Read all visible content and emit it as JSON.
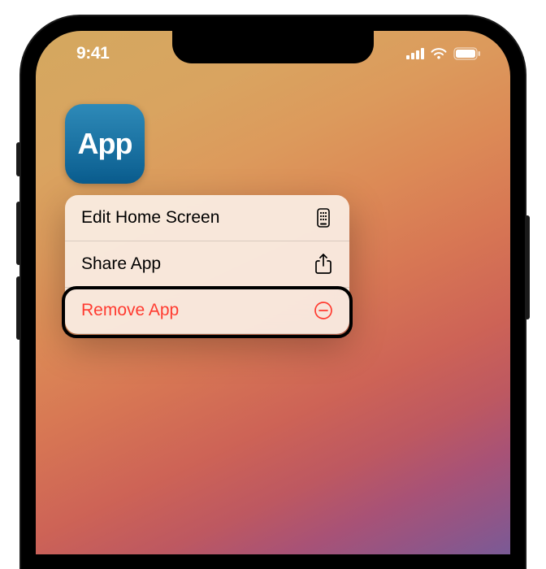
{
  "status_bar": {
    "time": "9:41"
  },
  "app": {
    "label": "App"
  },
  "menu": {
    "items": [
      {
        "label": "Edit Home Screen",
        "icon": "apps-icon",
        "destructive": false
      },
      {
        "label": "Share App",
        "icon": "share-icon",
        "destructive": false
      },
      {
        "label": "Remove App",
        "icon": "remove-icon",
        "destructive": true
      }
    ]
  }
}
